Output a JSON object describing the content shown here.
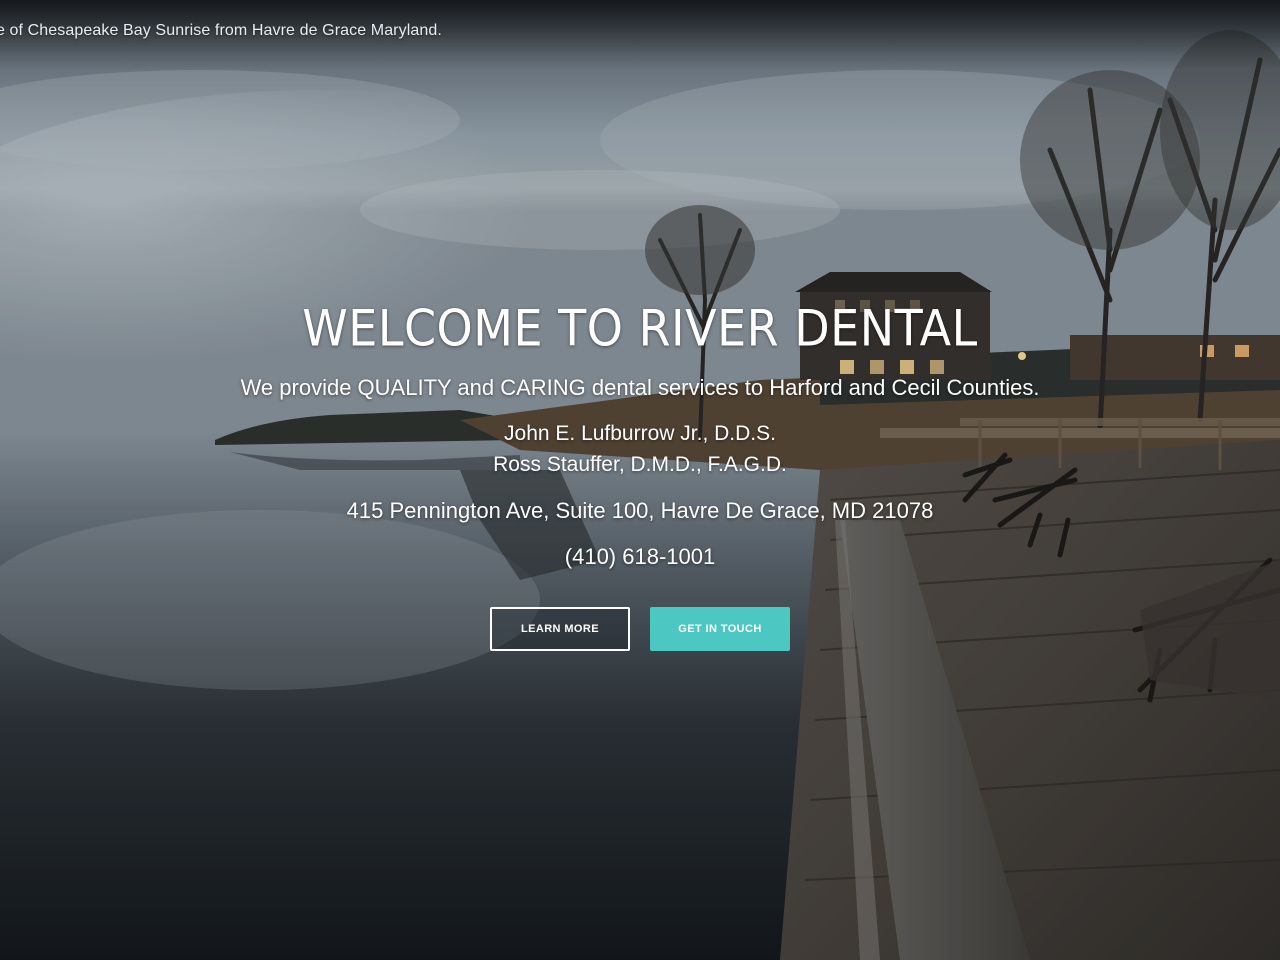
{
  "hero": {
    "image_caption": "e of Chesapeake Bay Sunrise from Havre de Grace Maryland.",
    "title": "WELCOME TO RIVER DENTAL",
    "tagline": "We provide QUALITY and CARING dental services to Harford and Cecil Counties.",
    "doctors": [
      "John E. Lufburrow Jr., D.D.S.",
      "Ross Stauffer, D.M.D., F.A.G.D."
    ],
    "address": "415 Pennington Ave, Suite 100, Havre De Grace, MD 21078",
    "phone": "(410) 618-1001",
    "buttons": {
      "learn_more": "LEARN MORE",
      "get_in_touch": "GET IN TOUCH"
    }
  },
  "colors": {
    "accent": "#4cc7c2",
    "text": "#ffffff"
  }
}
